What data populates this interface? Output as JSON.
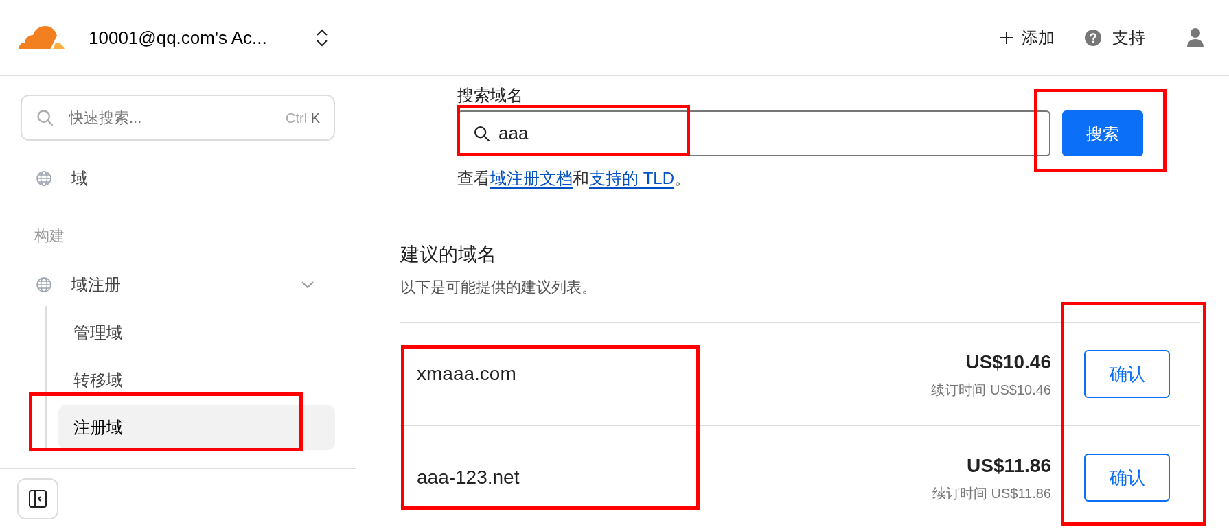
{
  "header": {
    "account": "10001@qq.com's Ac...",
    "actions": [
      {
        "kind": "add",
        "label": "添加"
      },
      {
        "kind": "help",
        "label": "支持"
      },
      {
        "kind": "user"
      }
    ]
  },
  "sidebar": {
    "search": {
      "placeholder": "快速搜索...",
      "shortcut_modifier": "Ctrl",
      "shortcut_key": "K"
    },
    "items": [
      {
        "kind": "link",
        "label": "域",
        "selected": false
      },
      {
        "kind": "heading",
        "label": "构建"
      },
      {
        "kind": "group",
        "label": "域注册",
        "expanded": true,
        "children": [
          {
            "label": "管理域",
            "selected": false,
            "highlighted": false
          },
          {
            "label": "转移域",
            "selected": false,
            "highlighted": false
          },
          {
            "label": "注册域",
            "selected": true,
            "highlighted": true
          }
        ]
      }
    ]
  },
  "search": {
    "label": "搜索域名",
    "value": "aaa",
    "field_highlighted": true,
    "button": "搜索",
    "button_highlighted": true,
    "help_prefix": "查看",
    "help_link_1": "域注册文档",
    "help_middle": "和",
    "help_link_2": "支持的 TLD",
    "help_suffix": "。"
  },
  "suggestions": {
    "title": "建议的域名",
    "subtitle": "以下是可能提供的建议列表。",
    "names_highlighted": true,
    "buttons_highlighted": true,
    "rows": [
      {
        "domain": "xmaaa.com",
        "price": "US$10.46",
        "renewal": "续订时间 US$10.46",
        "button": "确认"
      },
      {
        "domain": "aaa-123.net",
        "price": "US$11.86",
        "renewal": "续订时间 US$11.86",
        "button": "确认"
      }
    ]
  }
}
